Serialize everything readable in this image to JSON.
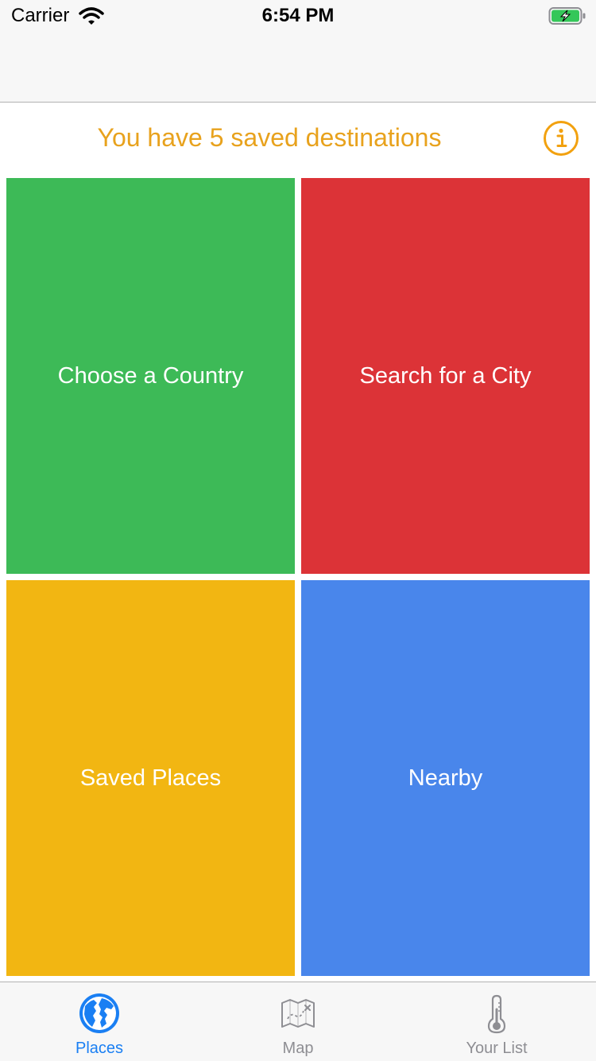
{
  "status_bar": {
    "carrier": "Carrier",
    "time": "6:54 PM",
    "battery_color": "#34c759"
  },
  "header": {
    "title": "You have 5 saved destinations",
    "accent_color": "#e8a21d",
    "info_icon": "info-icon"
  },
  "tiles": [
    {
      "label": "Choose a Country",
      "color": "#3dba57"
    },
    {
      "label": "Search for a City",
      "color": "#dc3337"
    },
    {
      "label": "Saved Places",
      "color": "#f2b612"
    },
    {
      "label": "Nearby",
      "color": "#4986eb"
    }
  ],
  "tab_bar": {
    "active_color": "#1a7ff3",
    "inactive_color": "#8e8e93",
    "tabs": [
      {
        "label": "Places",
        "icon": "globe-icon",
        "active": true
      },
      {
        "label": "Map",
        "icon": "map-icon",
        "active": false
      },
      {
        "label": "Your List",
        "icon": "thermometer-icon",
        "active": false
      }
    ]
  }
}
